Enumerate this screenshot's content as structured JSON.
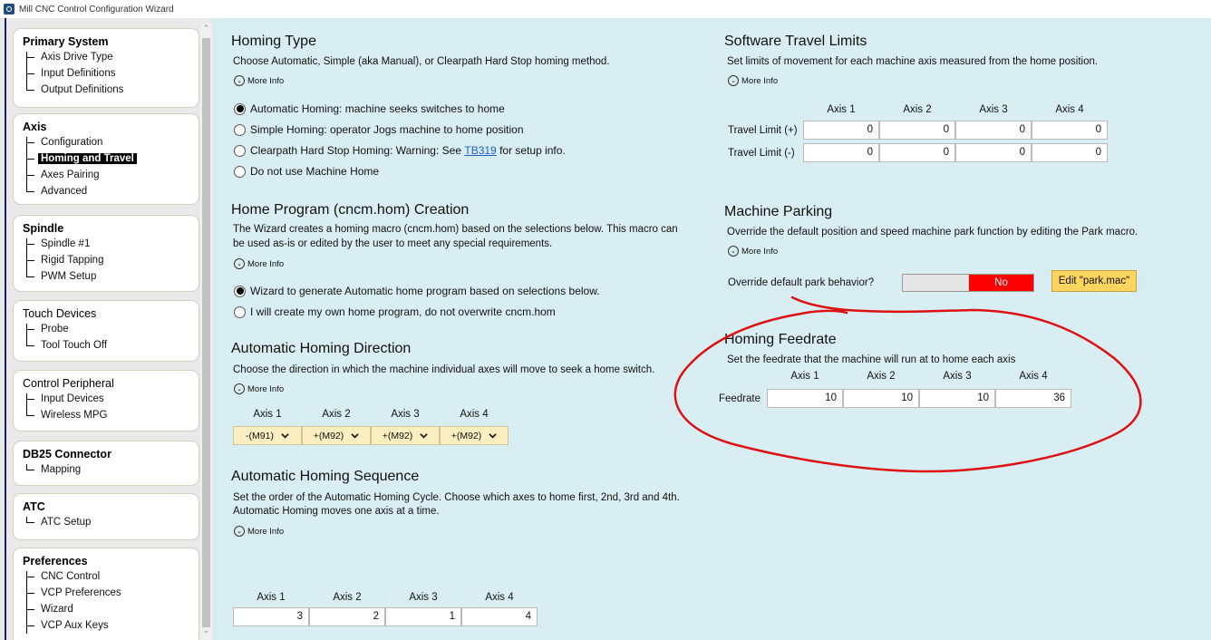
{
  "window": {
    "title": "Mill CNC Control Configuration Wizard"
  },
  "sidebar": {
    "primary": {
      "title": "Primary System",
      "items": [
        "Axis Drive Type",
        "Input Definitions",
        "Output Definitions"
      ]
    },
    "axis": {
      "title": "Axis",
      "items": [
        "Configuration",
        "Homing and Travel",
        "Axes Pairing",
        "Advanced"
      ],
      "selected": "Homing and Travel"
    },
    "spindle": {
      "title": "Spindle",
      "items": [
        "Spindle #1",
        "Rigid Tapping",
        "PWM Setup"
      ]
    },
    "touch": {
      "title": "Touch Devices",
      "items": [
        "Probe",
        "Tool Touch Off"
      ]
    },
    "peripheral": {
      "title": "Control Peripheral",
      "items": [
        "Input Devices",
        "Wireless MPG"
      ]
    },
    "db25": {
      "title": "DB25 Connector",
      "items": [
        "Mapping"
      ]
    },
    "atc": {
      "title": "ATC",
      "items": [
        "ATC Setup"
      ]
    },
    "prefs": {
      "title": "Preferences",
      "items": [
        "CNC Control",
        "VCP Preferences",
        "Wizard",
        "VCP Aux Keys"
      ]
    }
  },
  "more_info": "More Info",
  "axes": [
    "Axis 1",
    "Axis 2",
    "Axis 3",
    "Axis 4"
  ],
  "homing_type": {
    "title": "Homing Type",
    "desc": "Choose Automatic, Simple (aka Manual), or Clearpath Hard Stop homing method.",
    "options": [
      "Automatic Homing: machine seeks switches to home",
      "Simple Homing: operator Jogs machine to home position",
      "Clearpath Hard Stop Homing: Warning: See",
      "Do not use Machine Home"
    ],
    "link": "TB319",
    "link_suffix": "for setup info.",
    "selected_index": 0
  },
  "home_program": {
    "title": "Home Program (cncm.hom) Creation",
    "desc_line1": "The Wizard creates a homing macro (cncm.hom) based on the selections below.  This macro can",
    "desc_line2": "be used as-is or edited by the user to meet any special requirements.",
    "options": [
      "Wizard to generate Automatic home program based on selections below.",
      "I will create my own home program, do not overwrite cncm.hom"
    ],
    "selected_index": 0
  },
  "homing_direction": {
    "title": "Automatic Homing Direction",
    "desc": "Choose the direction in which the machine individual axes will move to seek a home switch.",
    "values": [
      "-(M91)",
      "+(M92)",
      "+(M92)",
      "+(M92)"
    ]
  },
  "homing_sequence": {
    "title": "Automatic Homing Sequence",
    "desc_line1": "Set the order of the Automatic Homing Cycle.  Choose which axes to home first, 2nd, 3rd and 4th.",
    "desc_line2": "Automatic Homing moves one axis at a time.",
    "values": [
      "3",
      "2",
      "1",
      "4"
    ]
  },
  "travel_limits": {
    "title": "Software Travel Limits",
    "desc": "Set limits of movement for each machine axis measured from the home position.",
    "plus_label": "Travel Limit (+)",
    "minus_label": "Travel Limit (-)",
    "plus": [
      "0",
      "0",
      "0",
      "0"
    ],
    "minus": [
      "0",
      "0",
      "0",
      "0"
    ]
  },
  "parking": {
    "title": "Machine Parking",
    "desc": "Override the default position and speed machine park function by editing the Park macro.",
    "override_label": "Override default park behavior?",
    "toggle_value": "No",
    "edit_button": "Edit \"park.mac\""
  },
  "feedrate": {
    "title": "Homing Feedrate",
    "desc": "Set the feedrate that the machine will run at to home each axis",
    "row_label": "Feedrate",
    "values": [
      "10",
      "10",
      "10",
      "36"
    ]
  },
  "colors": {
    "background": "#d9eef3",
    "toggle_off": "#ff0000",
    "edit_button": "#fbd560",
    "annotation": "#dd1111"
  }
}
